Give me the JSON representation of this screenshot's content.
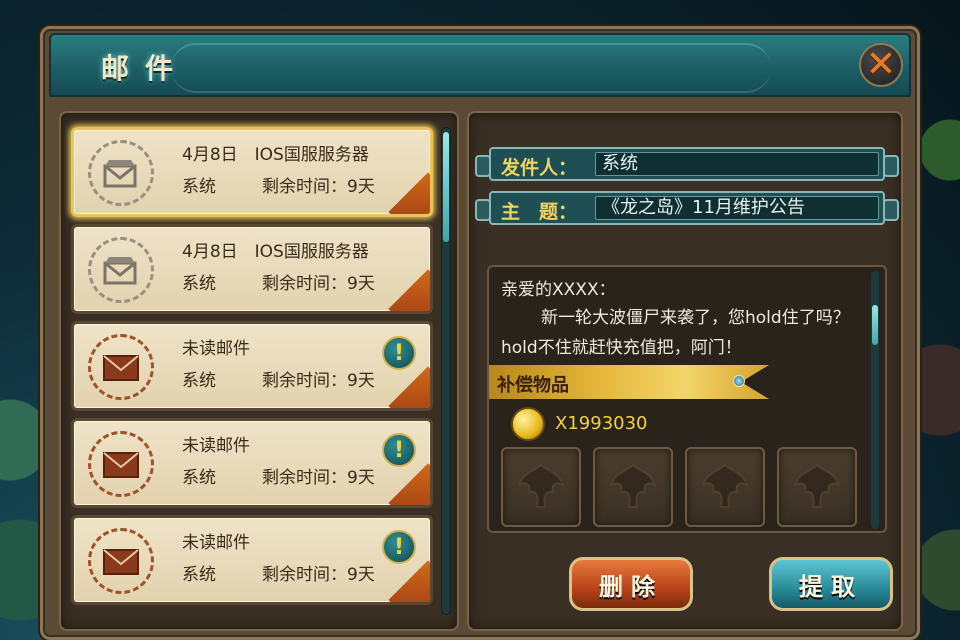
{
  "window": {
    "title": "邮件",
    "close_label": "✕"
  },
  "mail_list": [
    {
      "subject": "4月8日　IOS国服服务器",
      "sender": "系统",
      "time_left": "剩余时间：9天",
      "unread": false,
      "selected": true
    },
    {
      "subject": "4月8日　IOS国服服务器",
      "sender": "系统",
      "time_left": "剩余时间：9天",
      "unread": false,
      "selected": false
    },
    {
      "subject": "未读邮件",
      "sender": "系统",
      "time_left": "剩余时间：9天",
      "unread": true,
      "selected": false
    },
    {
      "subject": "未读邮件",
      "sender": "系统",
      "time_left": "剩余时间：9天",
      "unread": true,
      "selected": false
    },
    {
      "subject": "未读邮件",
      "sender": "系统",
      "time_left": "剩余时间：9天",
      "unread": true,
      "selected": false
    }
  ],
  "detail": {
    "sender_label": "发件人：",
    "sender_value": "系统",
    "subject_label": "主　题：",
    "subject_value": "《龙之岛》11月维护公告",
    "greeting": "亲爱的XXXX：",
    "body": "新一轮大波僵尸来袭了，您hold住了吗？hold不住就赶快充值把，阿门！",
    "rewards_title": "补偿物品",
    "coin_amount": "X1993030",
    "alert_glyph": "!"
  },
  "buttons": {
    "delete": "删除",
    "claim": "提取"
  },
  "colors": {
    "accent_teal": "#1d5f66",
    "title_text": "#f4e6c2",
    "label_gold": "#f1d45e",
    "delete_red": "#b8421a",
    "claim_teal": "#2a8a98"
  }
}
